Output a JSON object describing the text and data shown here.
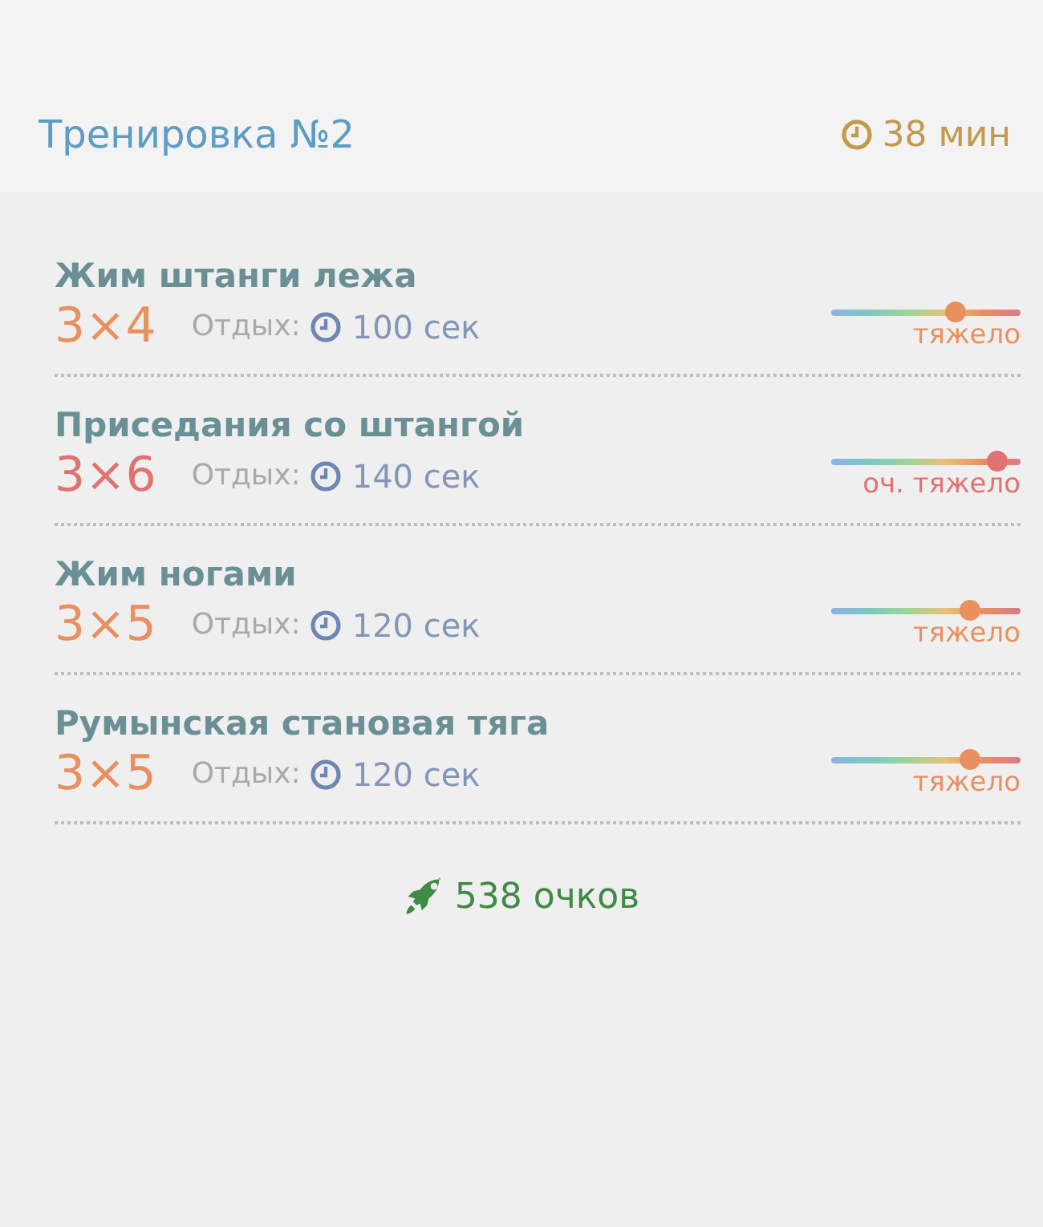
{
  "header": {
    "title": "Тренировка №2",
    "duration": "38 мин"
  },
  "exercises": [
    {
      "name": "Жим штанги лежа",
      "sets": "3×4",
      "rest_label": "Отдых:",
      "rest": "100 сек",
      "level": 0.65,
      "intensity": "тяжело",
      "color": "#e8905f"
    },
    {
      "name": "Приседания со штангой",
      "sets": "3×6",
      "rest_label": "Отдых:",
      "rest": "140 сек",
      "level": 0.87,
      "intensity": "оч. тяжело",
      "color": "#e07272"
    },
    {
      "name": "Жим ногами",
      "sets": "3×5",
      "rest_label": "Отдых:",
      "rest": "120 сек",
      "level": 0.73,
      "intensity": "тяжело",
      "color": "#e8905f"
    },
    {
      "name": "Румынская становая тяга",
      "sets": "3×5",
      "rest_label": "Отдых:",
      "rest": "120 сек",
      "level": 0.73,
      "intensity": "тяжело",
      "color": "#e8905f"
    }
  ],
  "footer": {
    "points": "538 очков"
  }
}
